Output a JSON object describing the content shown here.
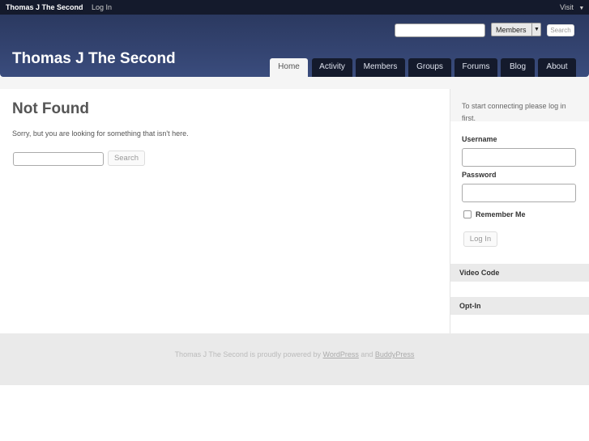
{
  "adminbar": {
    "site": "Thomas J The Second",
    "login": "Log In",
    "visit": "Visit"
  },
  "header": {
    "title": "Thomas J The Second",
    "search_scope": "Members",
    "search_button": "Search",
    "search_value": ""
  },
  "nav": [
    {
      "label": "Home",
      "active": true
    },
    {
      "label": "Activity"
    },
    {
      "label": "Members"
    },
    {
      "label": "Groups"
    },
    {
      "label": "Forums"
    },
    {
      "label": "Blog"
    },
    {
      "label": "About"
    }
  ],
  "main": {
    "title": "Not Found",
    "message": "Sorry, but you are looking for something that isn't here.",
    "search_button": "Search"
  },
  "sidebar": {
    "intro": "To start connecting please log in first.",
    "username_label": "Username",
    "password_label": "Password",
    "remember_label": "Remember Me",
    "login_button": "Log In",
    "widgets": [
      "Video Code",
      "Opt-In"
    ]
  },
  "footer": {
    "text_pre": "Thomas J The Second is proudly powered by ",
    "wordpress": "WordPress",
    "and": " and ",
    "buddypress": "BuddyPress"
  }
}
